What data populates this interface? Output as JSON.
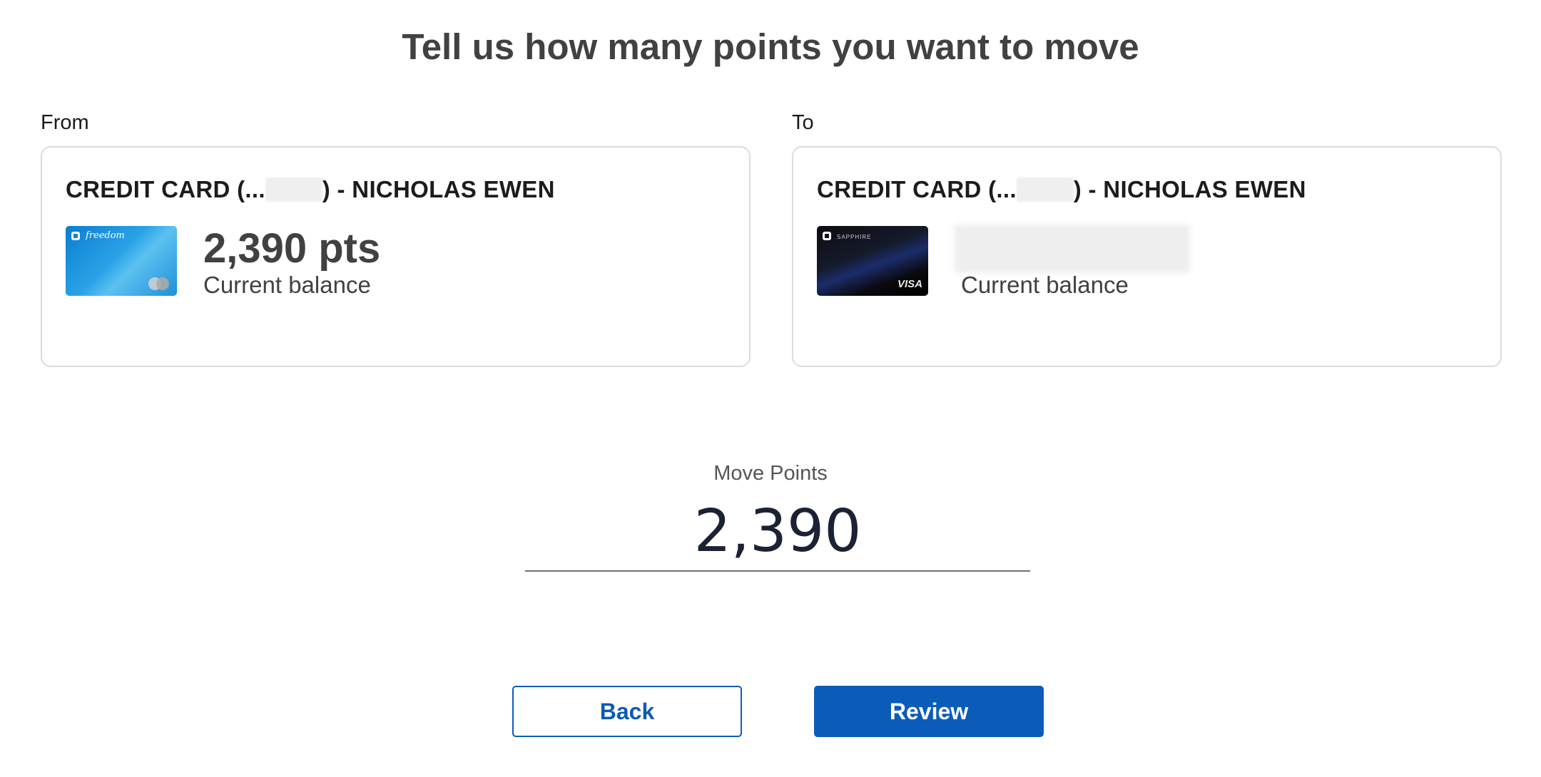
{
  "page": {
    "title": "Tell us how many points you want to move"
  },
  "from": {
    "label": "From",
    "account_prefix": "CREDIT CARD (...",
    "account_suffix": ") - NICHOLAS EWEN",
    "card_brand": "freedom",
    "balance": "2,390 pts",
    "balance_caption": "Current balance"
  },
  "to": {
    "label": "To",
    "account_prefix": "CREDIT CARD (...",
    "account_suffix": ") - NICHOLAS EWEN",
    "card_brand": "SAPPHIRE",
    "card_network": "VISA",
    "balance_caption": "Current balance"
  },
  "move": {
    "label": "Move Points",
    "value": "2,390"
  },
  "actions": {
    "back_label": "Back",
    "review_label": "Review"
  },
  "colors": {
    "primary": "#0b5cb8",
    "title": "#414042"
  },
  "icons": {
    "from_card": "freedom-card-icon",
    "to_card": "sapphire-card-icon"
  }
}
